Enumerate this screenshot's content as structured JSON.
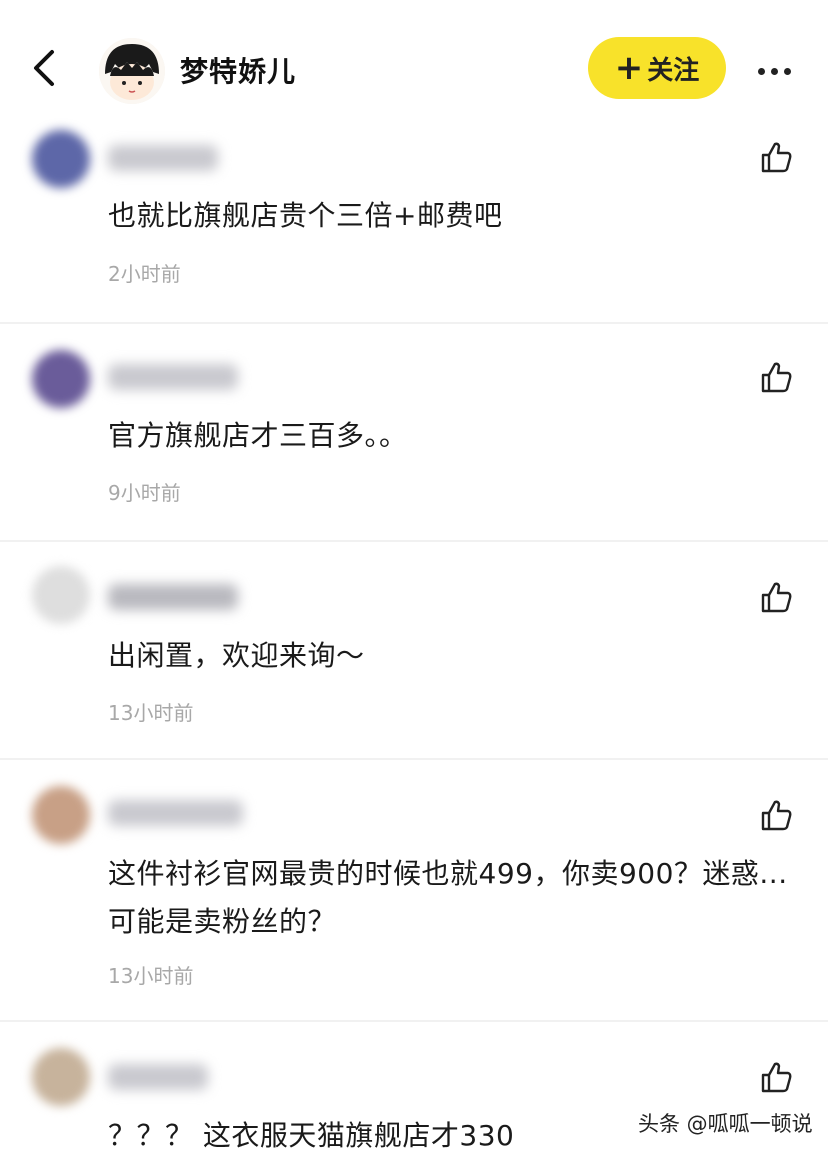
{
  "header": {
    "author_name": "梦特娇儿",
    "follow_label": "关注",
    "follow_plus": "+"
  },
  "comments": [
    {
      "text": "也就比旗舰店贵个三倍+邮费吧",
      "time": "2小时前"
    },
    {
      "text": "官方旗舰店才三百多。。",
      "time": "9小时前"
    },
    {
      "text": "出闲置，欢迎来询～",
      "time": "13小时前"
    },
    {
      "text": "这件衬衫官网最贵的时候也就499，你卖900？迷惑...可能是卖粉丝的？",
      "time": "13小时前"
    },
    {
      "text": "？？？ 这衣服天猫旗舰店才330",
      "time": ""
    }
  ],
  "watermark": "头条 @呱呱一顿说",
  "colors": {
    "follow_bg": "#f8e22a",
    "time_text": "#a8a8a8"
  },
  "icons": [
    "back-icon",
    "more-icon",
    "thumbs-up-icon"
  ]
}
